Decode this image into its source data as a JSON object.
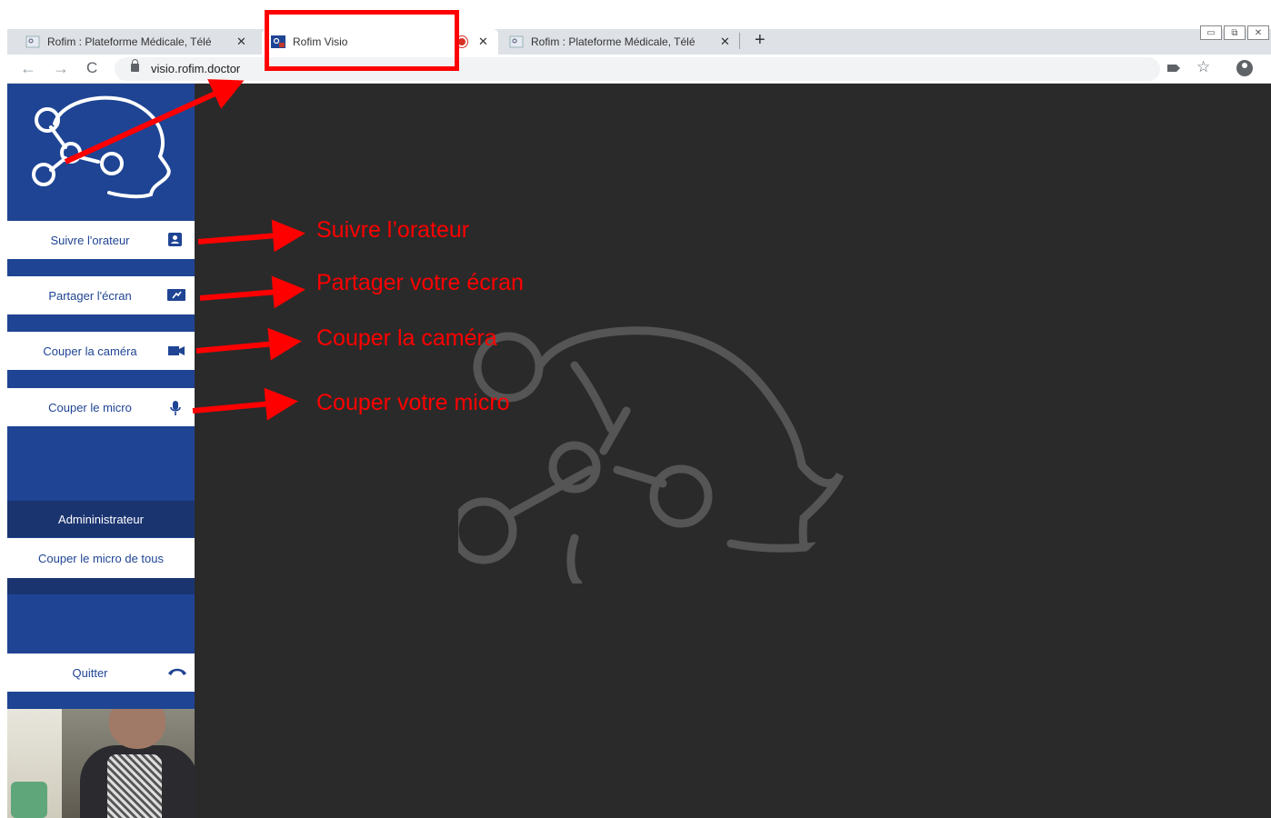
{
  "browser": {
    "tabs": [
      {
        "title": "Rofim : Plateforme Médicale, Télé",
        "close": "✕"
      },
      {
        "title": "Rofim Visio",
        "close": "✕"
      },
      {
        "title": "Rofim : Plateforme Médicale, Télé",
        "close": "✕"
      }
    ],
    "new_tab": "+",
    "url": "visio.rofim.doctor",
    "nav": {
      "back": "←",
      "forward": "→",
      "reload": "C"
    },
    "star": "☆"
  },
  "sidebar": {
    "buttons": {
      "follow_speaker": "Suivre l'orateur",
      "share_screen": "Partager l'écran",
      "cut_camera": "Couper la caméra",
      "cut_mic": "Couper le micro",
      "mute_all": "Couper le micro de tous",
      "quit": "Quitter"
    },
    "admin_header": "Admininistrateur"
  },
  "annotations": {
    "follow": "Suivre l’orateur",
    "share": "Partager votre écran",
    "camera": "Couper la caméra",
    "mic": "Couper votre micro"
  },
  "colors": {
    "sidebar": "#1f4494",
    "stage": "#2a2a2a",
    "annotation": "#ff0000"
  }
}
